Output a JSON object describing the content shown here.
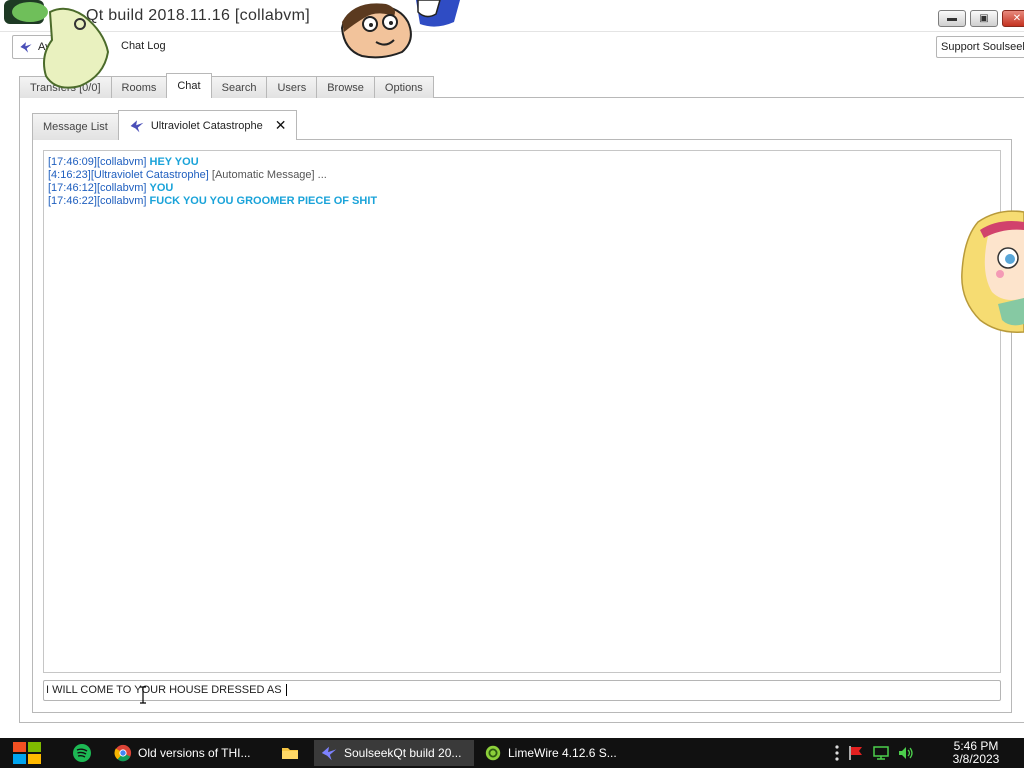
{
  "window": {
    "title": "Qt build 2018.11.16 [collabvm]",
    "controls": {
      "minimize": "▬",
      "maximize": "▣",
      "close": "✕"
    }
  },
  "toolbar": {
    "away_label": "Av",
    "chat_log_label": "Chat Log",
    "support_label": "Support Soulseek"
  },
  "main_tabs": [
    {
      "label": "Transfers [0/0]",
      "active": false
    },
    {
      "label": "Rooms",
      "active": false
    },
    {
      "label": "Chat",
      "active": true
    },
    {
      "label": "Search",
      "active": false
    },
    {
      "label": "Users",
      "active": false
    },
    {
      "label": "Browse",
      "active": false
    },
    {
      "label": "Options",
      "active": false
    }
  ],
  "sub_tabs": {
    "message_list": "Message List",
    "conversation": "Ultraviolet Catastrophe",
    "close_glyph": "✕"
  },
  "chat": {
    "messages": [
      {
        "time": "[17:46:09]",
        "user": "[collabvm]",
        "text": "HEY YOU",
        "automatic": false
      },
      {
        "time": "[4:16:23]",
        "user": "[Ultraviolet Catastrophe]",
        "text": "[Automatic Message] ...",
        "automatic": true
      },
      {
        "time": "[17:46:12]",
        "user": "[collabvm]",
        "text": "YOU",
        "automatic": false
      },
      {
        "time": "[17:46:22]",
        "user": "[collabvm]",
        "text": "FUCK YOU YOU GROOMER PIECE OF SHIT",
        "automatic": false
      }
    ],
    "input_value": "I WILL COME TO YOUR HOUSE DRESSED AS "
  },
  "taskbar": {
    "items": [
      {
        "label": "Old versions of THI...",
        "icon": "chrome-icon",
        "active": false
      },
      {
        "label": "SoulseekQt build 20...",
        "icon": "soulseek-bird-icon",
        "active": true
      },
      {
        "label": "LimeWire 4.12.6 S...",
        "icon": "limewire-icon",
        "active": false
      }
    ],
    "clock_time": "5:46 PM",
    "clock_date": "3/8/2023"
  },
  "colors": {
    "timestamp": "#1f5fbf",
    "message": "#1aa3d9",
    "taskbar": "#111111"
  }
}
